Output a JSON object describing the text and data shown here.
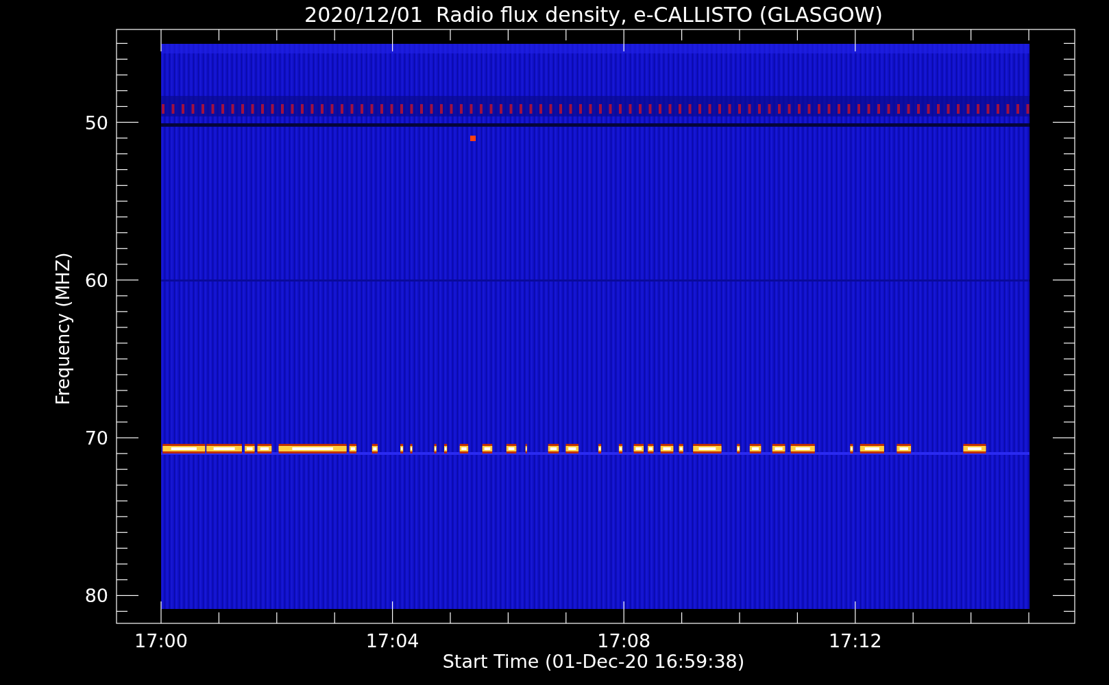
{
  "title": "2020/12/01  Radio flux density, e-CALLISTO (GLASGOW)",
  "y_axis": {
    "label": "Frequency (MHZ)",
    "ticks": [
      "50",
      "60",
      "70",
      "80"
    ]
  },
  "x_axis": {
    "label": "Start Time (01-Dec-20 16:59:38)",
    "ticks": [
      "17:00",
      "17:04",
      "17:08",
      "17:12"
    ]
  }
}
